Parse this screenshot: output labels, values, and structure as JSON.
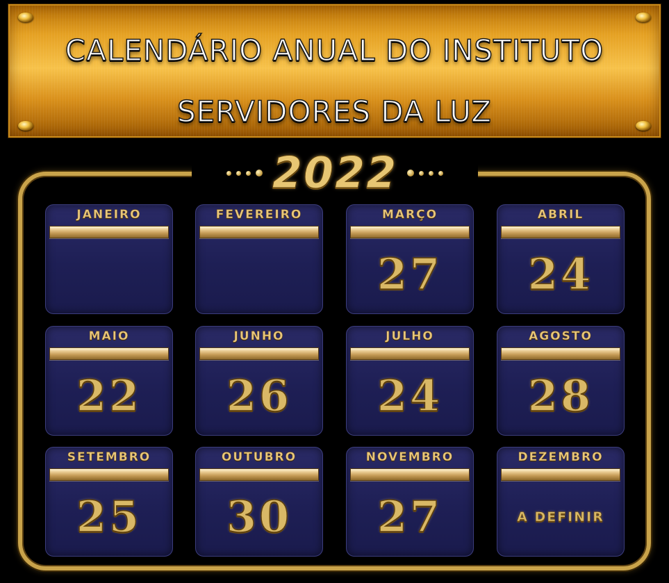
{
  "header": {
    "title_line1": "CALENDÁRIO ANUAL DO INSTITUTO",
    "title_line2": "SERVIDORES DA LUZ"
  },
  "calendar": {
    "year": "2022",
    "months": [
      {
        "name": "JANEIRO",
        "day": ""
      },
      {
        "name": "FEVEREIRO",
        "day": ""
      },
      {
        "name": "MARÇO",
        "day": "27"
      },
      {
        "name": "ABRIL",
        "day": "24"
      },
      {
        "name": "MAIO",
        "day": "22"
      },
      {
        "name": "JUNHO",
        "day": "26"
      },
      {
        "name": "JULHO",
        "day": "24"
      },
      {
        "name": "AGOSTO",
        "day": "28"
      },
      {
        "name": "SETEMBRO",
        "day": "25"
      },
      {
        "name": "OUTUBRO",
        "day": "30"
      },
      {
        "name": "NOVEMBRO",
        "day": "27"
      },
      {
        "name": "DEZEMBRO",
        "day": "A DEFINIR"
      }
    ]
  },
  "colors": {
    "plaque_gold": "#e5a123",
    "frame_gold": "#c9a34a",
    "card_navy": "#1e1f55",
    "text_gold": "#d9b866"
  }
}
